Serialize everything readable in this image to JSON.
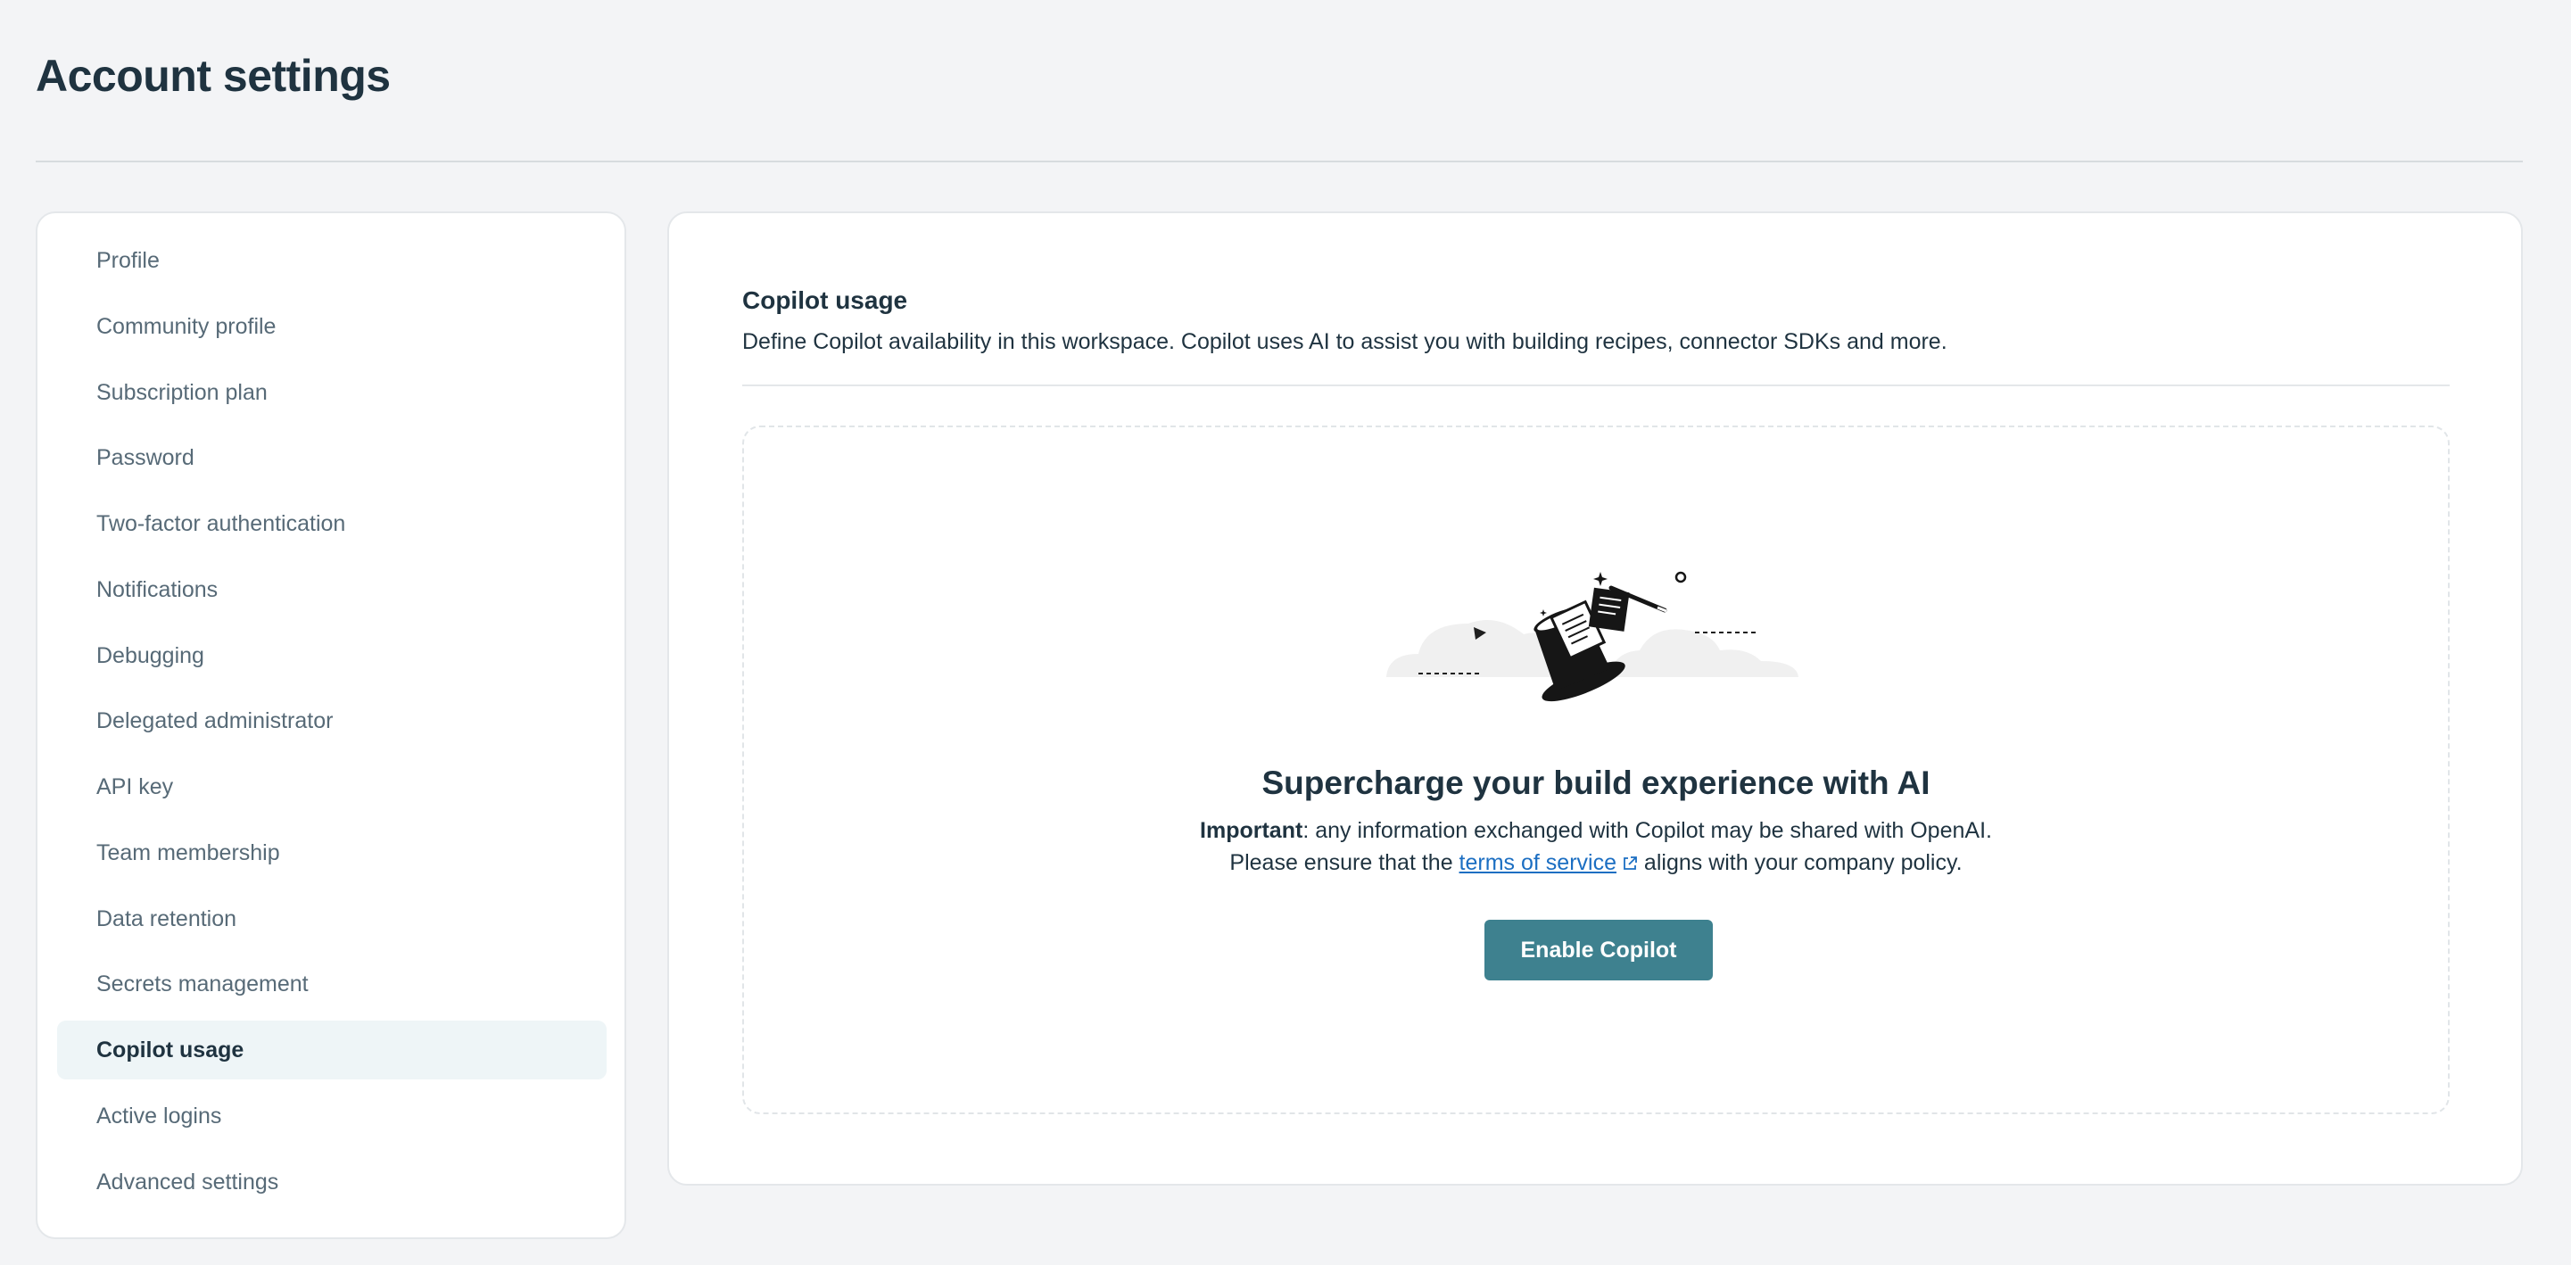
{
  "header": {
    "title": "Account settings"
  },
  "sidebar": {
    "items": [
      {
        "label": "Profile"
      },
      {
        "label": "Community profile"
      },
      {
        "label": "Subscription plan"
      },
      {
        "label": "Password"
      },
      {
        "label": "Two-factor authentication"
      },
      {
        "label": "Notifications"
      },
      {
        "label": "Debugging"
      },
      {
        "label": "Delegated administrator"
      },
      {
        "label": "API key"
      },
      {
        "label": "Team membership"
      },
      {
        "label": "Data retention"
      },
      {
        "label": "Secrets management"
      },
      {
        "label": "Copilot usage",
        "active": true
      },
      {
        "label": "Active logins"
      },
      {
        "label": "Advanced settings"
      }
    ]
  },
  "main": {
    "section_title": "Copilot usage",
    "section_description": "Define Copilot availability in this workspace. Copilot uses AI to assist you with building recipes, connector SDKs and more.",
    "empty_state": {
      "illustration_icon": "magic-hat-icon",
      "title": "Supercharge your build experience with AI",
      "important_label": "Important",
      "line1_rest": ": any information exchanged with Copilot may be shared with OpenAI.",
      "line2_prefix": "Please ensure that the ",
      "tos_link_text": "terms of service",
      "tos_link_icon": "external-link-icon",
      "line2_suffix": " aligns with your company policy.",
      "button_label": "Enable Copilot"
    }
  },
  "colors": {
    "background": "#f3f4f6",
    "text_primary": "#1f3340",
    "text_secondary": "#576a77",
    "active_nav_bg": "#eef5f7",
    "button_bg": "#3e818f",
    "link": "#1b6ec2"
  }
}
